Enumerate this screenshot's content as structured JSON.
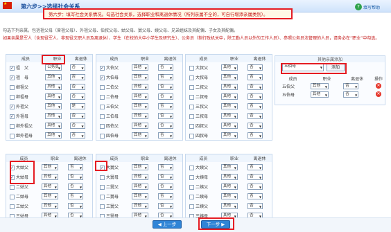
{
  "header": {
    "step_title": "第六步>>选择社会关系",
    "instruction": "第六步：填写社会关系情况。勾选社会关系，选择职业和离退休情况（所列亲属不全的，可自行增添亲属类别）。",
    "help_label": "填写帮助"
  },
  "notice": {
    "line1": "勾选下列亲属，包括祖父母（曾祖父母）、外祖父母、伯叔父母、姑父母、舅父母、姨父母、兄弟姐妹及其配偶、子女及其配偶。",
    "line2": "如果亲属是军人（含现役军人、非现役文职人员及离退休）、学生（在校的大中小学生及研究生）、公务员（指行政机关中，除工勤人员以外的工作人员）、参照公务员法管理的人员，请务必在“职业”中勾选。",
    "line3": ""
  },
  "columns": {
    "member": "成员",
    "job": "职业",
    "retire": "离退休"
  },
  "groups": [
    {
      "rows": [
        {
          "name": "祖　父",
          "checked": true,
          "job": "公务员",
          "retire": "否"
        },
        {
          "name": "祖　母",
          "checked": true,
          "job": "其他",
          "retire": "否"
        },
        {
          "name": "继祖父",
          "checked": false,
          "job": "其他",
          "retire": "否"
        },
        {
          "name": "继祖母",
          "checked": false,
          "job": "其他",
          "retire": "否"
        },
        {
          "name": "外祖父",
          "checked": true,
          "job": "其他",
          "retire": "是"
        },
        {
          "name": "外祖母",
          "checked": true,
          "job": "其他",
          "retire": "否"
        },
        {
          "name": "继外祖父",
          "checked": false,
          "job": "其他",
          "retire": "否"
        },
        {
          "name": "继外祖母",
          "checked": false,
          "job": "其他",
          "retire": "否"
        }
      ]
    },
    {
      "rows": [
        {
          "name": "大伯父",
          "checked": true,
          "job": "其他",
          "retire": "否"
        },
        {
          "name": "大伯母",
          "checked": true,
          "job": "其他",
          "retire": "否"
        },
        {
          "name": "二伯父",
          "checked": false,
          "job": "其他",
          "retire": "否"
        },
        {
          "name": "二伯母",
          "checked": false,
          "job": "其他",
          "retire": "否"
        },
        {
          "name": "三伯父",
          "checked": false,
          "job": "其他",
          "retire": "否"
        },
        {
          "name": "三伯母",
          "checked": false,
          "job": "其他",
          "retire": "否"
        },
        {
          "name": "四伯父",
          "checked": false,
          "job": "其他",
          "retire": "否"
        },
        {
          "name": "四伯母",
          "checked": false,
          "job": "其他",
          "retire": "否"
        }
      ]
    },
    {
      "rows": [
        {
          "name": "大叔父",
          "checked": false,
          "job": "其他",
          "retire": "否"
        },
        {
          "name": "大叔母",
          "checked": false,
          "job": "其他",
          "retire": "否"
        },
        {
          "name": "二叔父",
          "checked": false,
          "job": "其他",
          "retire": "否"
        },
        {
          "name": "二叔母",
          "checked": false,
          "job": "其他",
          "retire": "否"
        },
        {
          "name": "三叔父",
          "checked": false,
          "job": "其他",
          "retire": "否"
        },
        {
          "name": "三叔母",
          "checked": false,
          "job": "其他",
          "retire": "否"
        },
        {
          "name": "四叔父",
          "checked": false,
          "job": "其他",
          "retire": "否"
        },
        {
          "name": "四叔母",
          "checked": false,
          "job": "其他",
          "retire": "否"
        }
      ]
    },
    {
      "rows": [
        {
          "name": "大姑父",
          "checked": true,
          "job": "其他",
          "retire": "否"
        },
        {
          "name": "大姑母",
          "checked": true,
          "job": "其他",
          "retire": "否"
        },
        {
          "name": "二姑父",
          "checked": false,
          "job": "其他",
          "retire": "否"
        },
        {
          "name": "二姑母",
          "checked": false,
          "job": "其他",
          "retire": "否"
        },
        {
          "name": "三姑父",
          "checked": false,
          "job": "其他",
          "retire": "否"
        },
        {
          "name": "三姑母",
          "checked": false,
          "job": "其他",
          "retire": "否"
        }
      ]
    },
    {
      "rows": [
        {
          "name": "大舅父",
          "checked": true,
          "job": "其他",
          "retire": "否"
        },
        {
          "name": "大舅母",
          "checked": false,
          "job": "其他",
          "retire": "否"
        },
        {
          "name": "二舅父",
          "checked": false,
          "job": "其他",
          "retire": "否"
        },
        {
          "name": "二舅母",
          "checked": false,
          "job": "其他",
          "retire": "否"
        },
        {
          "name": "三舅父",
          "checked": false,
          "job": "其他",
          "retire": "否"
        },
        {
          "name": "三舅母",
          "checked": false,
          "job": "其他",
          "retire": "否"
        }
      ]
    },
    {
      "rows": [
        {
          "name": "大姨父",
          "checked": false,
          "job": "其他",
          "retire": "否"
        },
        {
          "name": "大姨母",
          "checked": false,
          "job": "其他",
          "retire": "否"
        },
        {
          "name": "二姨父",
          "checked": false,
          "job": "其他",
          "retire": "否"
        },
        {
          "name": "二姨母",
          "checked": false,
          "job": "其他",
          "retire": "否"
        },
        {
          "name": "三姨父",
          "checked": false,
          "job": "其他",
          "retire": "否"
        },
        {
          "name": "三姨母",
          "checked": false,
          "job": "其他",
          "retire": "否"
        }
      ]
    }
  ],
  "other": {
    "header": "其他亲属添加",
    "select_value": "五伯母",
    "add_label": "添加",
    "columns": {
      "member": "成员",
      "job": "职业",
      "retire": "离退休",
      "op": "操作"
    },
    "rows": [
      {
        "name": "五伯父",
        "job": "其他",
        "retire": "否"
      },
      {
        "name": "五伯母",
        "job": "其他",
        "retire": "否"
      }
    ]
  },
  "nav": {
    "prev": "上一步",
    "next": "下一步"
  }
}
